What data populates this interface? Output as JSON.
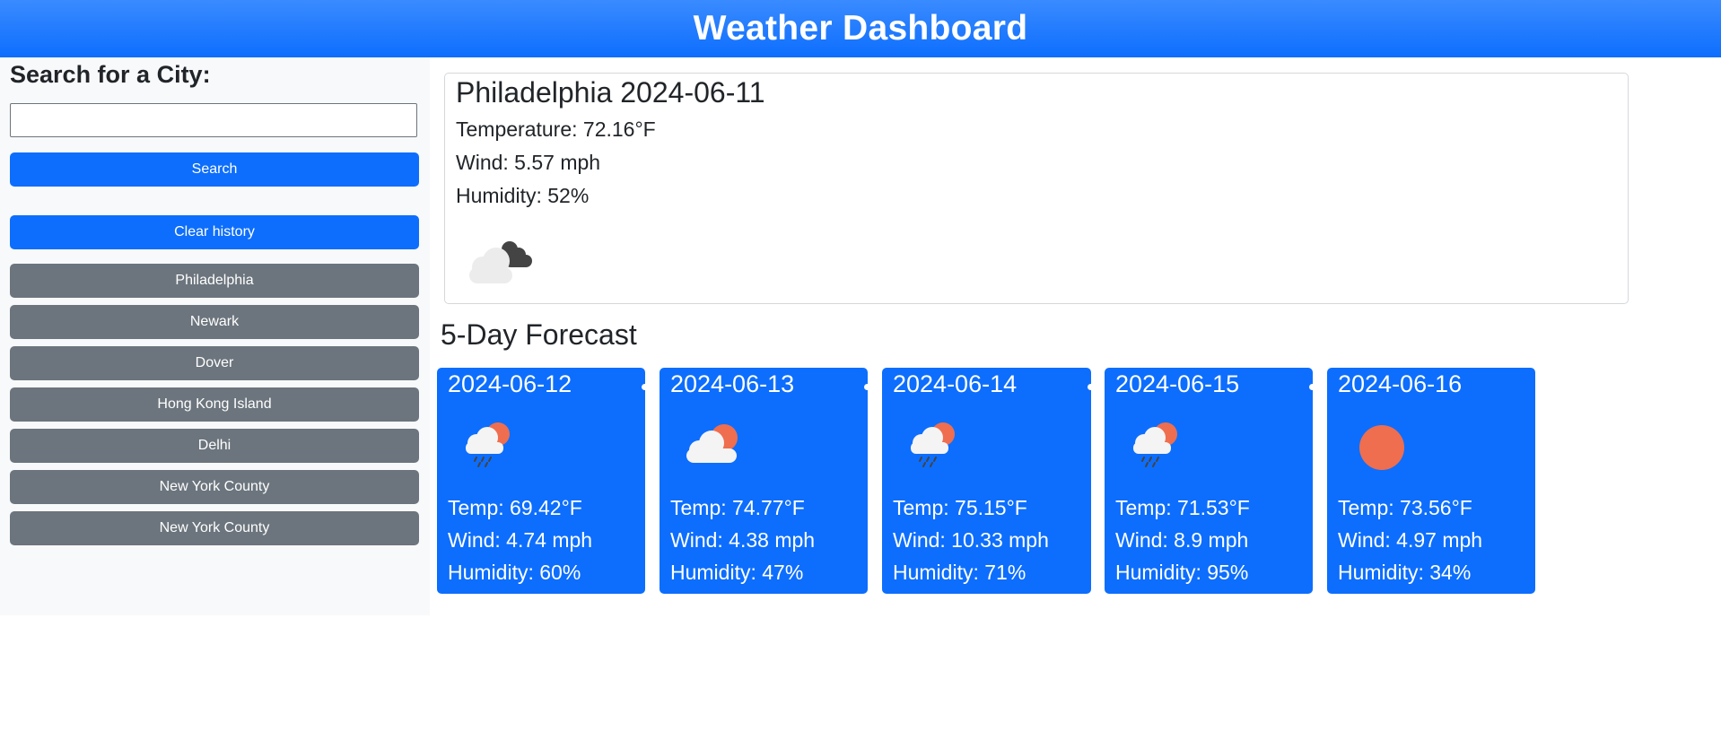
{
  "header": {
    "title": "Weather Dashboard"
  },
  "sidebar": {
    "heading": "Search for a City:",
    "search_value": "",
    "search_label": "Search",
    "clear_label": "Clear history",
    "history": [
      "Philadelphia",
      "Newark",
      "Dover",
      "Hong Kong Island",
      "Delhi",
      "New York County",
      "New York County"
    ]
  },
  "current": {
    "city_date": "Philadelphia 2024-06-11",
    "temperature": "Temperature: 72.16°F",
    "wind": "Wind: 5.57 mph",
    "humidity": "Humidity: 52%",
    "icon": "broken-clouds-icon"
  },
  "forecast": {
    "title": "5-Day Forecast",
    "days": [
      {
        "date": "2024-06-12",
        "temp": "Temp: 69.42°F",
        "wind": "Wind: 4.74 mph",
        "humidity": "Humidity: 60%",
        "icon": "rain-sun-icon"
      },
      {
        "date": "2024-06-13",
        "temp": "Temp: 74.77°F",
        "wind": "Wind: 4.38 mph",
        "humidity": "Humidity: 47%",
        "icon": "partly-cloudy-icon"
      },
      {
        "date": "2024-06-14",
        "temp": "Temp: 75.15°F",
        "wind": "Wind: 10.33 mph",
        "humidity": "Humidity: 71%",
        "icon": "rain-sun-icon"
      },
      {
        "date": "2024-06-15",
        "temp": "Temp: 71.53°F",
        "wind": "Wind: 8.9 mph",
        "humidity": "Humidity: 95%",
        "icon": "rain-sun-icon"
      },
      {
        "date": "2024-06-16",
        "temp": "Temp: 73.56°F",
        "wind": "Wind: 4.97 mph",
        "humidity": "Humidity: 34%",
        "icon": "clear-sun-icon"
      }
    ]
  },
  "colors": {
    "primary": "#0d6efd",
    "secondary": "#6c757d",
    "sun": "#ee6e4f"
  }
}
